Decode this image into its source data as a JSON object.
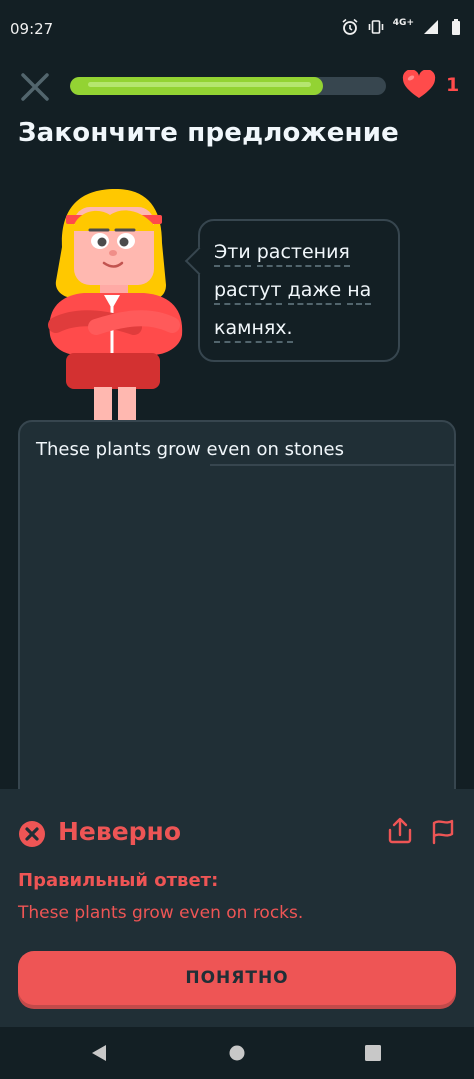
{
  "status_bar": {
    "time": "09:27",
    "network": "4G+",
    "icons": [
      "alarm-icon",
      "vibrate-icon",
      "network-icon",
      "signal-icon",
      "battery-icon"
    ]
  },
  "header": {
    "close_icon": "close-icon",
    "progress_fraction": 0.8,
    "hearts": "1",
    "heart_color": "#ff4b4b"
  },
  "exercise": {
    "title": "Закончите предложение",
    "prompt_words": [
      "Эти",
      "растения",
      "растут",
      "даже",
      "на",
      "камнях."
    ],
    "user_answer": "These plants grow even on stones"
  },
  "feedback": {
    "title": "Неверно",
    "label": "Правильный ответ:",
    "correct_answer": "These plants grow even on rocks.",
    "button": "ПОНЯТНО",
    "color": "#ee5555"
  },
  "colors": {
    "background": "#131f24",
    "panel": "#202f36",
    "border": "#37464f",
    "progress": "#93d333"
  }
}
